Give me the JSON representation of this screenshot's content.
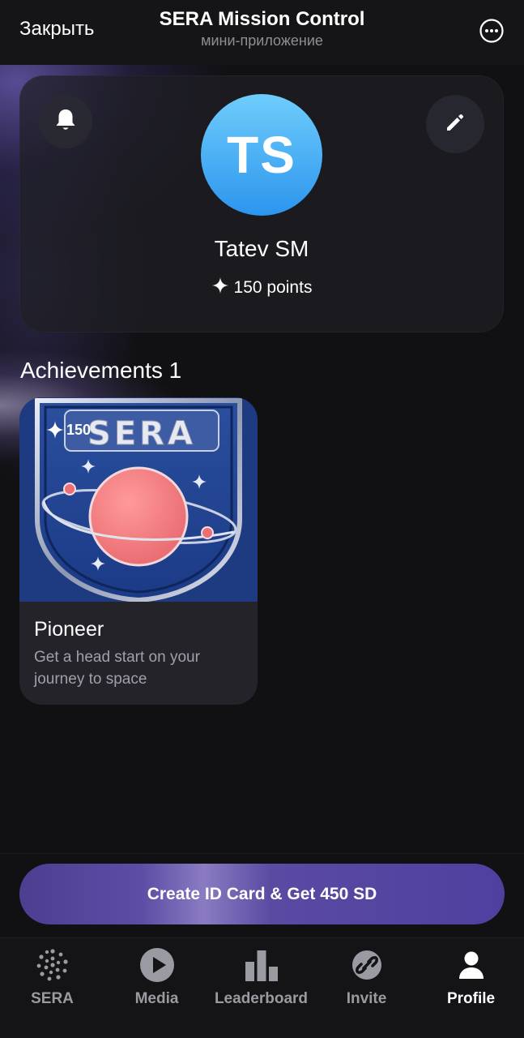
{
  "header": {
    "close_label": "Закрыть",
    "title": "SERA Mission Control",
    "subtitle": "мини-приложение",
    "more_icon": "ellipsis-circle-icon"
  },
  "profile": {
    "avatar_initials": "TS",
    "name": "Tatev SM",
    "points_text": "150 points",
    "bell_icon": "bell-icon",
    "edit_icon": "pencil-icon",
    "avatar_gradient": [
      "#6fcdfb",
      "#2c95ee"
    ]
  },
  "achievements": {
    "heading": "Achievements 1",
    "items": [
      {
        "points": "150",
        "badge_text": "SERA",
        "title": "Pioneer",
        "description": "Get a head start on your journey to space"
      }
    ]
  },
  "cta": {
    "label": "Create ID Card & Get 450 SD",
    "color": "#4f40a0"
  },
  "nav": {
    "items": [
      {
        "label": "SERA",
        "icon": "sera-logo-icon",
        "active": false
      },
      {
        "label": "Media",
        "icon": "play-circle-icon",
        "active": false
      },
      {
        "label": "Leaderboard",
        "icon": "bar-chart-icon",
        "active": false
      },
      {
        "label": "Invite",
        "icon": "link-icon",
        "active": false
      },
      {
        "label": "Profile",
        "icon": "person-icon",
        "active": true
      }
    ]
  },
  "colors": {
    "background": "#111114",
    "card": "#232329",
    "muted_text": "#a0a0a8",
    "accent": "#4f40a0"
  }
}
